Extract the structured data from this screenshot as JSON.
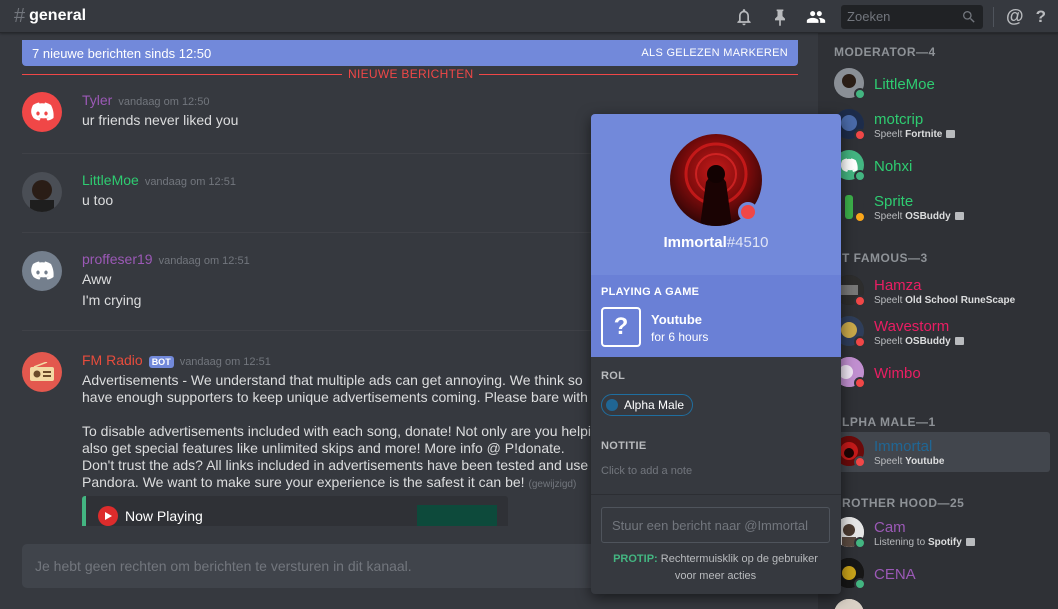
{
  "header": {
    "channel": "general",
    "search_placeholder": "Zoeken"
  },
  "banner": {
    "text": "7 nieuwe berichten sinds 12:50",
    "mark_read": "ALS GELEZEN MARKEREN"
  },
  "new_divider": "NIEUWE BERICHTEN",
  "messages": [
    {
      "author": "Tyler",
      "color": "#9b59b6",
      "time": "vandaag om 12:50",
      "lines": [
        "ur friends never liked you"
      ]
    },
    {
      "author": "LittleMoe",
      "color": "#2ecc71",
      "time": "vandaag om 12:51",
      "lines": [
        "u too"
      ]
    },
    {
      "author": "proffeser19",
      "color": "#9b59b6",
      "time": "vandaag om 12:51",
      "lines": [
        "Aww",
        "I'm crying"
      ]
    },
    {
      "author": "FM Radio",
      "color": "#e74c3c",
      "bot": "BOT",
      "time": "vandaag om 12:51",
      "lines": [
        "Advertisements - We understand that multiple ads can get annoying. We think so",
        "have enough supporters to keep unique advertisements coming. Please bare with u",
        "",
        "To disable advertisements included with each song, donate! Not only are you helpi",
        "also get special features like unlimited skips and more! More info @ P!donate.",
        "Don't trust the ads? All links included in advertisements have been tested and use",
        "Pandora. We want to make sure your experience is the safest it can be!"
      ],
      "edited": "(gewijzigd)",
      "embed_title": "Now Playing"
    }
  ],
  "input_placeholder": "Je hebt geen rechten om berichten te versturen in dit kanaal.",
  "members": {
    "sections": [
      {
        "title": "MODERATOR—4",
        "items": [
          {
            "name": "LittleMoe",
            "color": "#2ecc71",
            "status": "#43b581",
            "activity_prefix": "",
            "activity": ""
          },
          {
            "name": "motcrip",
            "color": "#2ecc71",
            "status": "#f04747",
            "activity_prefix": "Speelt",
            "activity": "Fortnite"
          },
          {
            "name": "Nohxi",
            "color": "#2ecc71",
            "status": "#43b581",
            "activity_prefix": "",
            "activity": ""
          },
          {
            "name": "Sprite",
            "color": "#2ecc71",
            "status": "#faa61a",
            "activity_prefix": "Speelt",
            "activity": "OSBuddy"
          }
        ]
      },
      {
        "title": "T FAMOUS—3",
        "items": [
          {
            "name": "Hamza",
            "color": "#e91e63",
            "status": "#f04747",
            "activity_prefix": "Speelt",
            "activity": "Old School RuneScape"
          },
          {
            "name": "Wavestorm",
            "color": "#e91e63",
            "status": "#f04747",
            "activity_prefix": "Speelt",
            "activity": "OSBuddy"
          },
          {
            "name": "Wimbo",
            "color": "#e91e63",
            "status": "#f04747",
            "activity_prefix": "",
            "activity": ""
          }
        ]
      },
      {
        "title": "LPHA MALE—1",
        "items": [
          {
            "name": "Immortal",
            "color": "#206694",
            "status": "#f04747",
            "activity_prefix": "Speelt",
            "activity": "Youtube"
          }
        ]
      },
      {
        "title": "ROTHER HOOD—25",
        "items": [
          {
            "name": "Cam",
            "color": "#9b59b6",
            "status": "#43b581",
            "activity_prefix": "Listening to",
            "activity": "Spotify"
          },
          {
            "name": "CENA",
            "color": "#9b59b6",
            "status": "#43b581",
            "activity_prefix": "",
            "activity": ""
          },
          {
            "name": "cuck",
            "color": "#9b59b6",
            "status": "#43b581",
            "activity_prefix": "",
            "activity": ""
          }
        ]
      }
    ]
  },
  "popout": {
    "username": "Immortal",
    "discriminator": "#4510",
    "game_label": "PLAYING A GAME",
    "game_name": "Youtube",
    "game_time": "for 6 hours",
    "role_label": "ROL",
    "role": "Alpha Male",
    "role_color": "#206694",
    "note_label": "NOTITIE",
    "note_placeholder": "Click to add a note",
    "message_placeholder": "Stuur een bericht naar @Immortal",
    "tip_label": "PROTIP:",
    "tip_text_1": "Rechtermuisklik op de gebruiker",
    "tip_text_2": "voor meer acties"
  }
}
